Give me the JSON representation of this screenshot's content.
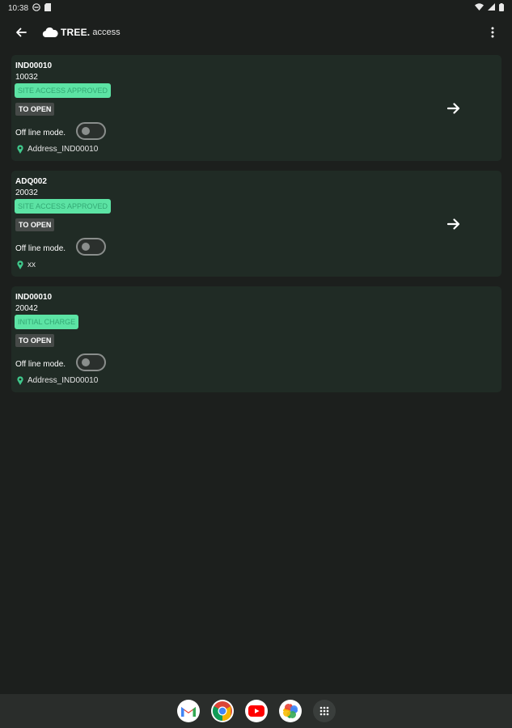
{
  "status_bar": {
    "time": "10:38",
    "icons": [
      "do-not-disturb-icon",
      "sd-card-icon",
      "wifi-icon",
      "signal-icon",
      "battery-icon"
    ]
  },
  "app_bar": {
    "brand_name": "TREE.",
    "brand_sub": "access",
    "icons": [
      "back-arrow-icon",
      "cloud-logo-icon",
      "more-vert-icon"
    ]
  },
  "colors": {
    "background": "#1c1f1d",
    "card": "#202b25",
    "status_badge_bg": "#5ce3a4",
    "status_badge_text": "#33a874",
    "pin": "#3fc98c"
  },
  "cards": [
    {
      "code": "IND00010",
      "number": "10032",
      "status": "SITE ACCESS APPROVED",
      "action": "TO OPEN",
      "offline_label": "Off line mode.",
      "offline_on": false,
      "address": "Address_IND00010",
      "has_arrow": true
    },
    {
      "code": "ADQ002",
      "number": "20032",
      "status": "SITE ACCESS APPROVED",
      "action": "TO OPEN",
      "offline_label": "Off line mode.",
      "offline_on": false,
      "address": "xx",
      "has_arrow": true
    },
    {
      "code": "IND00010",
      "number": "20042",
      "status": "INITIAL CHARGE",
      "action": "TO OPEN",
      "offline_label": "Off line mode.",
      "offline_on": false,
      "address": "Address_IND00010",
      "has_arrow": false
    }
  ],
  "dock": {
    "apps": [
      "gmail-icon",
      "chrome-icon",
      "youtube-icon",
      "photos-icon",
      "app-drawer-icon"
    ]
  }
}
